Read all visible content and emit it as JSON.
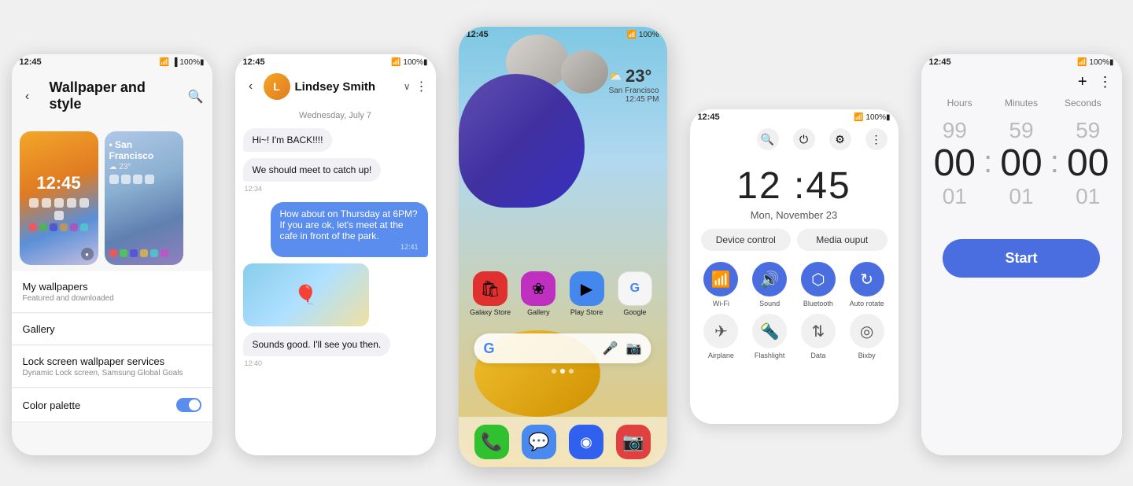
{
  "panel1": {
    "status_time": "12:45",
    "title": "Wallpaper and style",
    "menu_items": [
      {
        "label": "My wallpapers",
        "sub": "Featured and downloaded"
      },
      {
        "label": "Gallery",
        "sub": ""
      },
      {
        "label": "Lock screen wallpaper services",
        "sub": "Dynamic Lock screen, Samsung Global Goals"
      },
      {
        "label": "Color palette",
        "sub": "",
        "toggle": true
      }
    ]
  },
  "panel2": {
    "status_time": "12:45",
    "contact_name": "Lindsey Smith",
    "date_divider": "Wednesday, July 7",
    "messages": [
      {
        "type": "received",
        "text": "Hi~! I'm BACK!!!!"
      },
      {
        "type": "received",
        "text": "We should meet to catch up!",
        "time": "12:34"
      },
      {
        "type": "sent",
        "text": "How about on Thursday at 6PM? If you are ok, let's meet at the cafe in front of the park.",
        "time": "12:41"
      },
      {
        "type": "image"
      },
      {
        "type": "received",
        "text": "Sounds good. I'll see you then.",
        "time": "12:40"
      }
    ]
  },
  "panel3": {
    "status_time": "12:45",
    "weather_temp": "23°",
    "weather_loc": "San Francisco",
    "weather_time": "12:45 PM",
    "apps": [
      {
        "label": "Galaxy Store",
        "color": "#e03030",
        "icon": "🛍"
      },
      {
        "label": "Gallery",
        "color": "#c030c0",
        "icon": "❀"
      },
      {
        "label": "Play Store",
        "color": "#4488ee",
        "icon": "▶"
      },
      {
        "label": "Google",
        "color": "#f5f5f5",
        "icon": "G"
      }
    ],
    "dock_apps": [
      {
        "label": "Phone",
        "color": "#30c030",
        "icon": "📞"
      },
      {
        "label": "Messages",
        "color": "#4a8aee",
        "icon": "💬"
      },
      {
        "label": "Samsung",
        "color": "#3060ee",
        "icon": "◉"
      },
      {
        "label": "Camera",
        "color": "#e04040",
        "icon": "📷"
      }
    ]
  },
  "panel4": {
    "status_time": "12:45",
    "clock_time": "12 :45",
    "date": "Mon, November 23",
    "tab1": "Device control",
    "tab2": "Media ouput",
    "tiles": [
      {
        "label": "Wi-Fi",
        "active": true,
        "icon": "📶"
      },
      {
        "label": "Sound",
        "active": true,
        "icon": "🔊"
      },
      {
        "label": "Bluetooth",
        "active": true,
        "icon": "⬡"
      },
      {
        "label": "Auto rotate",
        "active": true,
        "icon": "↻"
      }
    ],
    "tiles2": [
      {
        "label": "Airplane",
        "icon": "✈"
      },
      {
        "label": "Flashlight",
        "icon": "🔦"
      },
      {
        "label": "Data",
        "icon": "⇅"
      },
      {
        "label": "Bixby",
        "icon": "◎"
      }
    ]
  },
  "panel5": {
    "status_time": "12:45",
    "col_labels": [
      "Hours",
      "Minutes",
      "Seconds"
    ],
    "columns": [
      {
        "top": "99",
        "mid": "00",
        "bot": "01"
      },
      {
        "top": "59",
        "mid": "00",
        "bot": "01"
      },
      {
        "top": "59",
        "mid": "00",
        "bot": "01"
      }
    ],
    "start_label": "Start"
  }
}
